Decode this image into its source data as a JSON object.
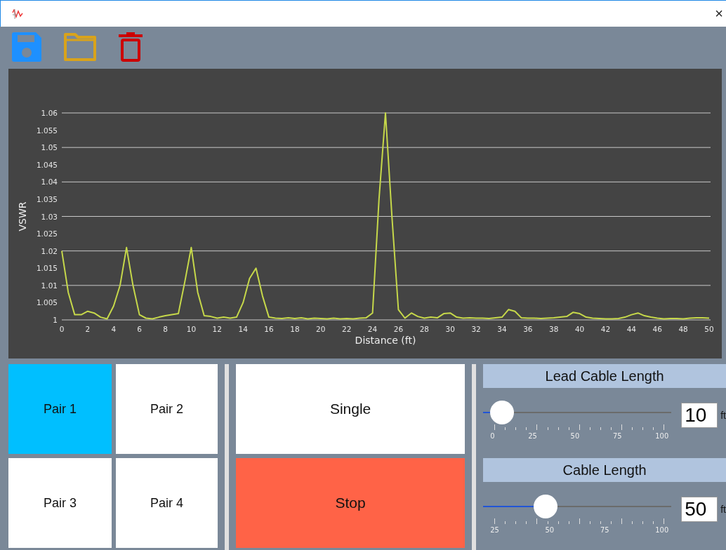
{
  "window": {
    "close": "×"
  },
  "toolbar": [
    {
      "kind": "save"
    },
    {
      "kind": "open"
    },
    {
      "kind": "delete"
    }
  ],
  "chart": {
    "chart_data": {
      "type": "line",
      "xlabel": "Distance (ft)",
      "ylabel": "VSWR",
      "xlim": [
        0,
        50
      ],
      "ylim": [
        1,
        1.06
      ],
      "grid": true,
      "xticks": [
        0,
        2,
        4,
        6,
        8,
        10,
        12,
        14,
        16,
        18,
        20,
        22,
        24,
        26,
        28,
        30,
        32,
        34,
        36,
        38,
        40,
        42,
        44,
        46,
        48,
        50
      ],
      "yticks": [
        1,
        1.005,
        1.01,
        1.015,
        1.02,
        1.025,
        1.03,
        1.035,
        1.04,
        1.045,
        1.05,
        1.055,
        1.06
      ],
      "x": [
        0,
        0.5,
        1,
        1.5,
        2,
        2.5,
        3,
        3.5,
        4,
        4.5,
        5,
        5.5,
        6,
        6.5,
        7,
        7.5,
        8,
        8.5,
        9,
        9.5,
        10,
        10.5,
        11,
        11.5,
        12,
        12.5,
        13,
        13.5,
        14,
        14.5,
        15,
        15.5,
        16,
        16.5,
        17,
        17.5,
        18,
        18.5,
        19,
        19.5,
        20,
        20.5,
        21,
        21.5,
        22,
        22.5,
        23,
        23.5,
        24,
        24.5,
        25,
        25.5,
        26,
        26.5,
        27,
        27.5,
        28,
        28.5,
        29,
        29.5,
        30,
        30.5,
        31,
        31.5,
        32,
        32.5,
        33,
        33.5,
        34,
        34.5,
        35,
        35.5,
        36,
        36.5,
        37,
        37.5,
        38,
        38.5,
        39,
        39.5,
        40,
        40.5,
        41,
        41.5,
        42,
        42.5,
        43,
        43.5,
        44,
        44.5,
        45,
        45.5,
        46,
        46.5,
        47,
        47.5,
        48,
        48.5,
        49,
        49.5,
        50
      ],
      "series": [
        {
          "color": "#c6d84a",
          "values": [
            1.02,
            1.008,
            1.0015,
            1.0015,
            1.0025,
            1.002,
            1.0008,
            1.0003,
            1.004,
            1.01,
            1.021,
            1.01,
            1.0015,
            1.0005,
            1.0003,
            1.0008,
            1.0012,
            1.0015,
            1.0018,
            1.011,
            1.021,
            1.008,
            1.0012,
            1.001,
            1.0005,
            1.0008,
            1.0005,
            1.0008,
            1.005,
            1.012,
            1.015,
            1.007,
            1.0008,
            1.0005,
            1.0004,
            1.0006,
            1.0004,
            1.0006,
            1.0003,
            1.0005,
            1.0004,
            1.0003,
            1.0005,
            1.0003,
            1.0004,
            1.0003,
            1.0005,
            1.0006,
            1.002,
            1.035,
            1.06,
            1.03,
            1.003,
            1.0005,
            1.002,
            1.001,
            1.0005,
            1.0008,
            1.0006,
            1.0018,
            1.002,
            1.0008,
            1.0005,
            1.0006,
            1.0005,
            1.0005,
            1.0004,
            1.0006,
            1.0008,
            1.003,
            1.0025,
            1.0006,
            1.0005,
            1.0005,
            1.0004,
            1.0005,
            1.0006,
            1.0008,
            1.001,
            1.0022,
            1.0018,
            1.0008,
            1.0005,
            1.0004,
            1.0003,
            1.0003,
            1.0004,
            1.0008,
            1.0015,
            1.002,
            1.0012,
            1.0008,
            1.0005,
            1.0003,
            1.0004,
            1.0004,
            1.0003,
            1.0005,
            1.0006,
            1.0006,
            1.0005
          ]
        }
      ]
    }
  },
  "pairs": [
    {
      "label": "Pair 1",
      "selected": true
    },
    {
      "label": "Pair 2",
      "selected": false
    },
    {
      "label": "Pair 3",
      "selected": false
    },
    {
      "label": "Pair 4",
      "selected": false
    }
  ],
  "actions": [
    {
      "label": "Single",
      "kind": "single"
    },
    {
      "label": "Stop",
      "kind": "stop"
    }
  ],
  "settings": [
    {
      "title": "Lead Cable Length",
      "level": 0.1,
      "ticks": [
        "0",
        "25",
        "50",
        "75",
        "100"
      ],
      "value": "10",
      "unit": "ft"
    },
    {
      "title": "Cable Length",
      "level": 0.333,
      "ticks": [
        "25",
        "50",
        "75",
        "100"
      ],
      "value": "50",
      "unit": "ft"
    }
  ]
}
